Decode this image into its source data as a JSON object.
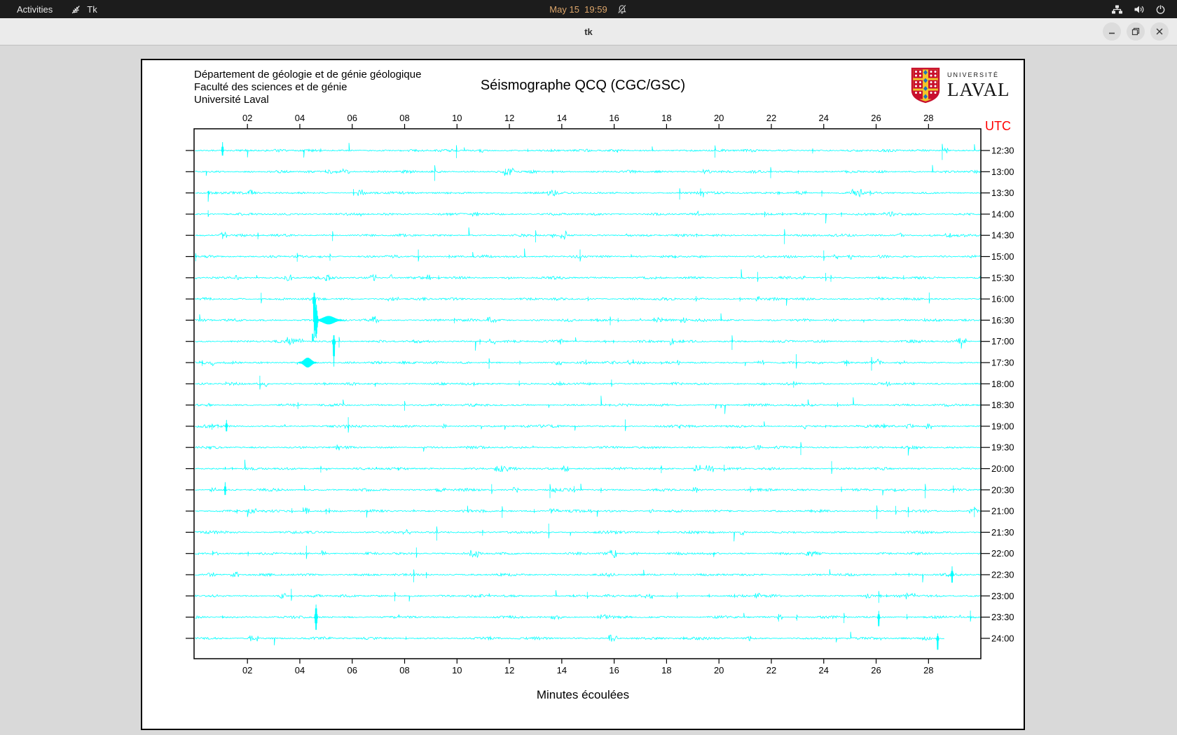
{
  "top_bar": {
    "activities_label": "Activities",
    "app_name": "Tk",
    "clock": "May 15  19:59",
    "clock_color": "#dca56a"
  },
  "titlebar": {
    "title": "tk",
    "buttons": [
      "minimize",
      "maximize",
      "close"
    ]
  },
  "plot": {
    "header_lines": [
      "Département de géologie et de génie géologique",
      "Faculté des sciences et de génie",
      "Université Laval"
    ],
    "title": "Séismographe QCQ (CGC/GSC)",
    "logo": {
      "line1": "UNIVERSITÉ",
      "line2": "LAVAL"
    },
    "utc_label": "UTC",
    "utc_color": "#ff0000",
    "xlabel": "Minutes écoulées"
  },
  "chart_data": {
    "type": "line",
    "subtype": "helicorder-seismogram",
    "station": "QCQ (CGC/GSC)",
    "title": "Séismographe QCQ (CGC/GSC)",
    "xlabel": "Minutes écoulées",
    "x_range_minutes": [
      0,
      30
    ],
    "x_ticks": [
      "02",
      "04",
      "06",
      "08",
      "10",
      "12",
      "14",
      "16",
      "18",
      "20",
      "22",
      "24",
      "26",
      "28"
    ],
    "row_labels_utc": [
      "12:30",
      "13:00",
      "13:30",
      "14:00",
      "14:30",
      "15:00",
      "15:30",
      "16:00",
      "16:30",
      "17:00",
      "17:30",
      "18:00",
      "18:30",
      "19:00",
      "19:30",
      "20:00",
      "20:30",
      "21:00",
      "21:30",
      "22:00",
      "22:30",
      "23:00",
      "23:30",
      "24:00"
    ],
    "trace_color": "#00ffff",
    "last_row_end_minute": 28.6,
    "noise_seed": 20240515,
    "events": [
      {
        "row": 7,
        "minute": 4.55,
        "up": 10,
        "down": 56,
        "width": 0.06
      },
      {
        "row": 8,
        "minute": 4.62,
        "up": 24,
        "down": 26,
        "width": 0.1
      },
      {
        "row": 8,
        "minute": 5.1,
        "up": 6,
        "down": 6,
        "width": 0.55
      },
      {
        "row": 9,
        "minute": 5.3,
        "up": 10,
        "down": 36,
        "width": 0.06
      },
      {
        "row": 0,
        "minute": 1.05,
        "up": 12,
        "down": 9,
        "width": 0.05
      },
      {
        "row": 10,
        "minute": 4.3,
        "up": 7,
        "down": 7,
        "width": 0.35
      },
      {
        "row": 13,
        "minute": 1.2,
        "up": 9,
        "down": 9,
        "width": 0.05
      },
      {
        "row": 16,
        "minute": 1.15,
        "up": 11,
        "down": 9,
        "width": 0.05
      },
      {
        "row": 20,
        "minute": 28.9,
        "up": 12,
        "down": 14,
        "width": 0.05
      },
      {
        "row": 22,
        "minute": 4.62,
        "up": 18,
        "down": 20,
        "width": 0.07
      },
      {
        "row": 22,
        "minute": 26.1,
        "up": 9,
        "down": 16,
        "width": 0.05
      },
      {
        "row": 23,
        "minute": 28.35,
        "up": 7,
        "down": 20,
        "width": 0.05
      }
    ]
  }
}
